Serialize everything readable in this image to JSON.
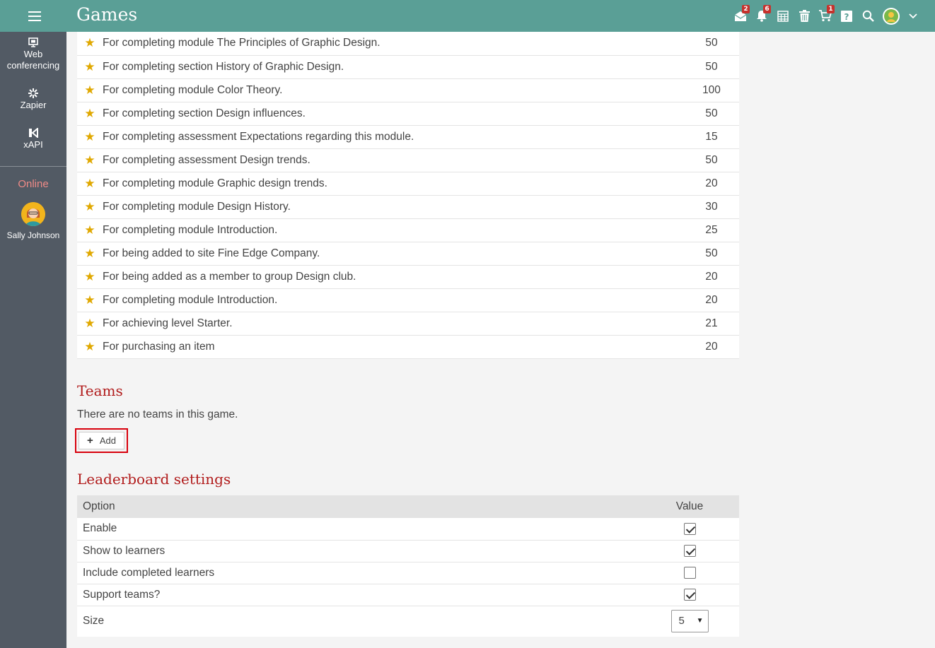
{
  "app": {
    "title": "Games"
  },
  "topbar": {
    "icons": [
      {
        "name": "messages-icon",
        "badge": "2"
      },
      {
        "name": "notifications-icon",
        "badge": "6"
      },
      {
        "name": "calendar-icon",
        "badge": ""
      },
      {
        "name": "trash-icon",
        "badge": ""
      },
      {
        "name": "cart-icon",
        "badge": "1"
      },
      {
        "name": "help-icon",
        "badge": ""
      },
      {
        "name": "search-icon",
        "badge": ""
      }
    ],
    "badges": {
      "messages": "2",
      "notifications": "6",
      "cart": "1"
    }
  },
  "sidebar": {
    "items": [
      {
        "label1": "Web",
        "label2": "conferencing",
        "icon": "monitor-icon"
      },
      {
        "label1": "Zapier",
        "icon": "asterisk-icon"
      },
      {
        "label1": "xAPI",
        "icon": "xapi-icon"
      }
    ],
    "online_label": "Online",
    "online_user": "Sally Johnson"
  },
  "points": {
    "rows": [
      {
        "desc": "For completing module The Principles of Graphic Design.",
        "points": "50"
      },
      {
        "desc": "For completing section History of Graphic Design.",
        "points": "50"
      },
      {
        "desc": "For completing module Color Theory.",
        "points": "100"
      },
      {
        "desc": "For completing section Design influences.",
        "points": "50"
      },
      {
        "desc": "For completing assessment Expectations regarding this module.",
        "points": "15"
      },
      {
        "desc": "For completing assessment Design trends.",
        "points": "50"
      },
      {
        "desc": "For completing module Graphic design trends.",
        "points": "20"
      },
      {
        "desc": "For completing module Design History.",
        "points": "30"
      },
      {
        "desc": "For completing module Introduction.",
        "points": "25"
      },
      {
        "desc": "For being added to site Fine Edge Company.",
        "points": "50"
      },
      {
        "desc": "For being added as a member to group Design club.",
        "points": "20"
      },
      {
        "desc": "For completing module Introduction.",
        "points": "20"
      },
      {
        "desc": "For achieving level Starter.",
        "points": "21"
      },
      {
        "desc": "For purchasing an item",
        "points": "20"
      }
    ]
  },
  "teams": {
    "title": "Teams",
    "empty_text": "There are no teams in this game.",
    "add_label": "Add"
  },
  "leaderboard": {
    "title": "Leaderboard settings",
    "col_option": "Option",
    "col_value": "Value",
    "rows": [
      {
        "label": "Enable",
        "checked": true
      },
      {
        "label": "Show to learners",
        "checked": true
      },
      {
        "label": "Include completed learners",
        "checked": false
      },
      {
        "label": "Support teams?",
        "checked": true
      }
    ],
    "size_label": "Size",
    "size_value": "5"
  },
  "colors": {
    "topbar": "#5a9f96",
    "sidebar": "#525a64",
    "accent_title": "#b11b1b",
    "star": "#e0a800",
    "badge": "#c6322d",
    "highlight_border": "#d8000c"
  }
}
